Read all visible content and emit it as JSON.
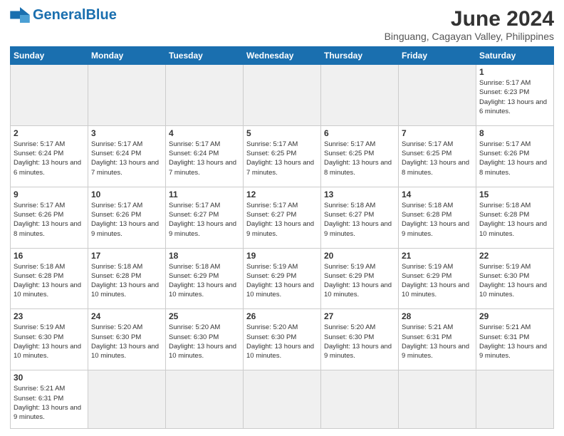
{
  "header": {
    "logo_general": "General",
    "logo_blue": "Blue",
    "month_year": "June 2024",
    "location": "Binguang, Cagayan Valley, Philippines"
  },
  "days_of_week": [
    "Sunday",
    "Monday",
    "Tuesday",
    "Wednesday",
    "Thursday",
    "Friday",
    "Saturday"
  ],
  "weeks": [
    {
      "days": [
        {
          "num": "",
          "info": "",
          "empty": true
        },
        {
          "num": "",
          "info": "",
          "empty": true
        },
        {
          "num": "",
          "info": "",
          "empty": true
        },
        {
          "num": "",
          "info": "",
          "empty": true
        },
        {
          "num": "",
          "info": "",
          "empty": true
        },
        {
          "num": "",
          "info": "",
          "empty": true
        },
        {
          "num": "1",
          "info": "Sunrise: 5:17 AM\nSunset: 6:23 PM\nDaylight: 13 hours and 6 minutes.",
          "empty": false
        }
      ]
    },
    {
      "days": [
        {
          "num": "2",
          "info": "Sunrise: 5:17 AM\nSunset: 6:24 PM\nDaylight: 13 hours and 6 minutes.",
          "empty": false
        },
        {
          "num": "3",
          "info": "Sunrise: 5:17 AM\nSunset: 6:24 PM\nDaylight: 13 hours and 7 minutes.",
          "empty": false
        },
        {
          "num": "4",
          "info": "Sunrise: 5:17 AM\nSunset: 6:24 PM\nDaylight: 13 hours and 7 minutes.",
          "empty": false
        },
        {
          "num": "5",
          "info": "Sunrise: 5:17 AM\nSunset: 6:25 PM\nDaylight: 13 hours and 7 minutes.",
          "empty": false
        },
        {
          "num": "6",
          "info": "Sunrise: 5:17 AM\nSunset: 6:25 PM\nDaylight: 13 hours and 8 minutes.",
          "empty": false
        },
        {
          "num": "7",
          "info": "Sunrise: 5:17 AM\nSunset: 6:25 PM\nDaylight: 13 hours and 8 minutes.",
          "empty": false
        },
        {
          "num": "8",
          "info": "Sunrise: 5:17 AM\nSunset: 6:26 PM\nDaylight: 13 hours and 8 minutes.",
          "empty": false
        }
      ]
    },
    {
      "days": [
        {
          "num": "9",
          "info": "Sunrise: 5:17 AM\nSunset: 6:26 PM\nDaylight: 13 hours and 8 minutes.",
          "empty": false
        },
        {
          "num": "10",
          "info": "Sunrise: 5:17 AM\nSunset: 6:26 PM\nDaylight: 13 hours and 9 minutes.",
          "empty": false
        },
        {
          "num": "11",
          "info": "Sunrise: 5:17 AM\nSunset: 6:27 PM\nDaylight: 13 hours and 9 minutes.",
          "empty": false
        },
        {
          "num": "12",
          "info": "Sunrise: 5:17 AM\nSunset: 6:27 PM\nDaylight: 13 hours and 9 minutes.",
          "empty": false
        },
        {
          "num": "13",
          "info": "Sunrise: 5:18 AM\nSunset: 6:27 PM\nDaylight: 13 hours and 9 minutes.",
          "empty": false
        },
        {
          "num": "14",
          "info": "Sunrise: 5:18 AM\nSunset: 6:28 PM\nDaylight: 13 hours and 9 minutes.",
          "empty": false
        },
        {
          "num": "15",
          "info": "Sunrise: 5:18 AM\nSunset: 6:28 PM\nDaylight: 13 hours and 10 minutes.",
          "empty": false
        }
      ]
    },
    {
      "days": [
        {
          "num": "16",
          "info": "Sunrise: 5:18 AM\nSunset: 6:28 PM\nDaylight: 13 hours and 10 minutes.",
          "empty": false
        },
        {
          "num": "17",
          "info": "Sunrise: 5:18 AM\nSunset: 6:28 PM\nDaylight: 13 hours and 10 minutes.",
          "empty": false
        },
        {
          "num": "18",
          "info": "Sunrise: 5:18 AM\nSunset: 6:29 PM\nDaylight: 13 hours and 10 minutes.",
          "empty": false
        },
        {
          "num": "19",
          "info": "Sunrise: 5:19 AM\nSunset: 6:29 PM\nDaylight: 13 hours and 10 minutes.",
          "empty": false
        },
        {
          "num": "20",
          "info": "Sunrise: 5:19 AM\nSunset: 6:29 PM\nDaylight: 13 hours and 10 minutes.",
          "empty": false
        },
        {
          "num": "21",
          "info": "Sunrise: 5:19 AM\nSunset: 6:29 PM\nDaylight: 13 hours and 10 minutes.",
          "empty": false
        },
        {
          "num": "22",
          "info": "Sunrise: 5:19 AM\nSunset: 6:30 PM\nDaylight: 13 hours and 10 minutes.",
          "empty": false
        }
      ]
    },
    {
      "days": [
        {
          "num": "23",
          "info": "Sunrise: 5:19 AM\nSunset: 6:30 PM\nDaylight: 13 hours and 10 minutes.",
          "empty": false
        },
        {
          "num": "24",
          "info": "Sunrise: 5:20 AM\nSunset: 6:30 PM\nDaylight: 13 hours and 10 minutes.",
          "empty": false
        },
        {
          "num": "25",
          "info": "Sunrise: 5:20 AM\nSunset: 6:30 PM\nDaylight: 13 hours and 10 minutes.",
          "empty": false
        },
        {
          "num": "26",
          "info": "Sunrise: 5:20 AM\nSunset: 6:30 PM\nDaylight: 13 hours and 10 minutes.",
          "empty": false
        },
        {
          "num": "27",
          "info": "Sunrise: 5:20 AM\nSunset: 6:30 PM\nDaylight: 13 hours and 9 minutes.",
          "empty": false
        },
        {
          "num": "28",
          "info": "Sunrise: 5:21 AM\nSunset: 6:31 PM\nDaylight: 13 hours and 9 minutes.",
          "empty": false
        },
        {
          "num": "29",
          "info": "Sunrise: 5:21 AM\nSunset: 6:31 PM\nDaylight: 13 hours and 9 minutes.",
          "empty": false
        }
      ]
    },
    {
      "days": [
        {
          "num": "30",
          "info": "Sunrise: 5:21 AM\nSunset: 6:31 PM\nDaylight: 13 hours and 9 minutes.",
          "empty": false
        },
        {
          "num": "",
          "info": "",
          "empty": true
        },
        {
          "num": "",
          "info": "",
          "empty": true
        },
        {
          "num": "",
          "info": "",
          "empty": true
        },
        {
          "num": "",
          "info": "",
          "empty": true
        },
        {
          "num": "",
          "info": "",
          "empty": true
        },
        {
          "num": "",
          "info": "",
          "empty": true
        }
      ]
    }
  ]
}
